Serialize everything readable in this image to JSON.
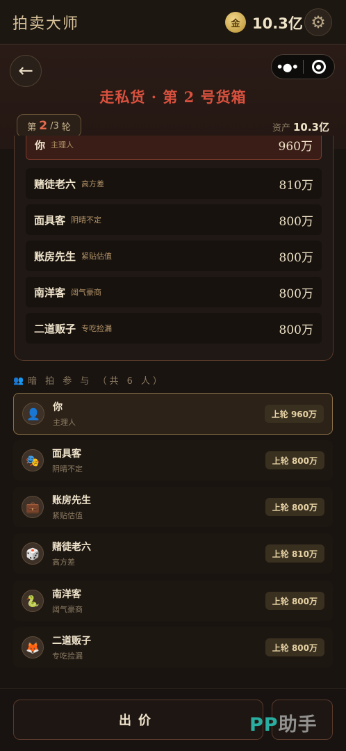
{
  "topbar": {
    "app_title": "拍卖大师",
    "coin_label": "金",
    "assets": "10.3亿",
    "settings_icon": "gear-icon"
  },
  "header": {
    "back_icon": "arrow-left-icon",
    "capsule": {
      "more_icon": "more-dots-icon",
      "close_icon": "record-circle-icon"
    },
    "title": "走私货 · 第 2 号货箱",
    "round": {
      "prefix": "第",
      "current": "2",
      "total": "/3",
      "suffix": "轮"
    },
    "assets_label": "资产",
    "assets_value": "10.3亿"
  },
  "bids": [
    {
      "name": "你",
      "tag": "主理人",
      "amount": "960万",
      "is_you": true
    },
    {
      "name": "赌徒老六",
      "tag": "高方差",
      "amount": "810万"
    },
    {
      "name": "面具客",
      "tag": "阴晴不定",
      "amount": "800万"
    },
    {
      "name": "账房先生",
      "tag": "紧贴估值",
      "amount": "800万"
    },
    {
      "name": "南洋客",
      "tag": "阔气豪商",
      "amount": "800万"
    },
    {
      "name": "二道贩子",
      "tag": "专吃捡漏",
      "amount": "800万"
    }
  ],
  "participants": {
    "header": "暗 拍 参 与 （共 6 人）",
    "list": [
      {
        "name": "你",
        "tag": "主理人",
        "last": "上轮 960万",
        "avatar": "👤"
      },
      {
        "name": "面具客",
        "tag": "阴晴不定",
        "last": "上轮 800万",
        "avatar": "🎭"
      },
      {
        "name": "账房先生",
        "tag": "紧贴估值",
        "last": "上轮 800万",
        "avatar": "💼"
      },
      {
        "name": "赌徒老六",
        "tag": "高方差",
        "last": "上轮 810万",
        "avatar": "🎲"
      },
      {
        "name": "南洋客",
        "tag": "阔气豪商",
        "last": "上轮 800万",
        "avatar": "🐍"
      },
      {
        "name": "二道贩子",
        "tag": "专吃捡漏",
        "last": "上轮 800万",
        "avatar": "🦊"
      }
    ]
  },
  "footer": {
    "bid_label": "出价",
    "watermark_a": "PP",
    "watermark_b": "助手"
  }
}
